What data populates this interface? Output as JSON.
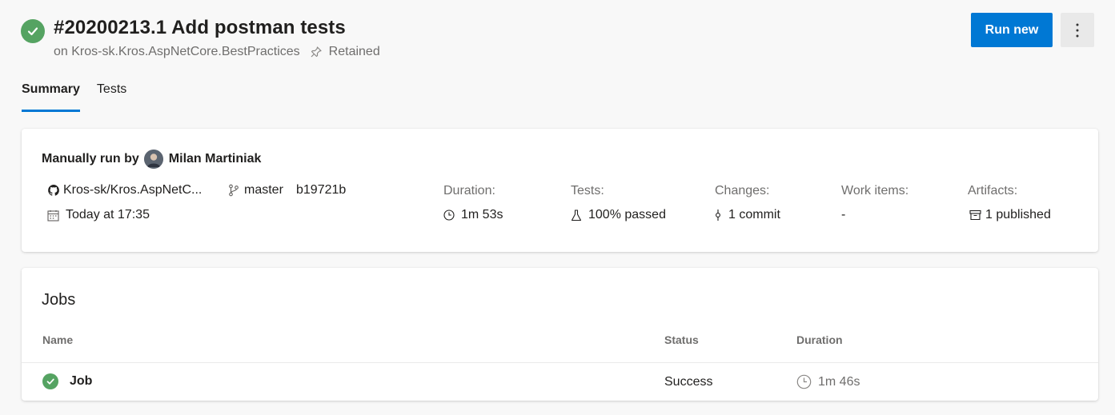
{
  "header": {
    "title": "#20200213.1 Add postman tests",
    "subtitle_repo": "on Kros-sk.Kros.AspNetCore.BestPractices",
    "retained_label": "Retained",
    "run_new_label": "Run new",
    "status_icon": "success-check-icon",
    "more_icon": "more-vertical-icon"
  },
  "tabs": [
    {
      "label": "Summary",
      "active": true
    },
    {
      "label": "Tests",
      "active": false
    }
  ],
  "summary": {
    "run_by_prefix": "Manually run by",
    "user_name": "Milan Martiniak",
    "repo": "Kros-sk/Kros.AspNetC...",
    "branch": "master",
    "commit": "b19721b",
    "date": "Today at 17:35",
    "duration_label": "Duration:",
    "duration_value": "1m 53s",
    "tests_label": "Tests:",
    "tests_value": "100% passed",
    "changes_label": "Changes:",
    "changes_value": "1 commit",
    "work_items_label": "Work items:",
    "work_items_value": "-",
    "artifacts_label": "Artifacts:",
    "artifacts_value": "1 published"
  },
  "jobs": {
    "title": "Jobs",
    "columns": [
      "Name",
      "Status",
      "Duration"
    ],
    "rows": [
      {
        "name": "Job",
        "status": "Success",
        "duration": "1m 46s"
      }
    ]
  },
  "colors": {
    "accent": "#0078d4",
    "success": "#55a362",
    "background": "#f8f8f8",
    "secondary_text": "#6f6e6d"
  }
}
